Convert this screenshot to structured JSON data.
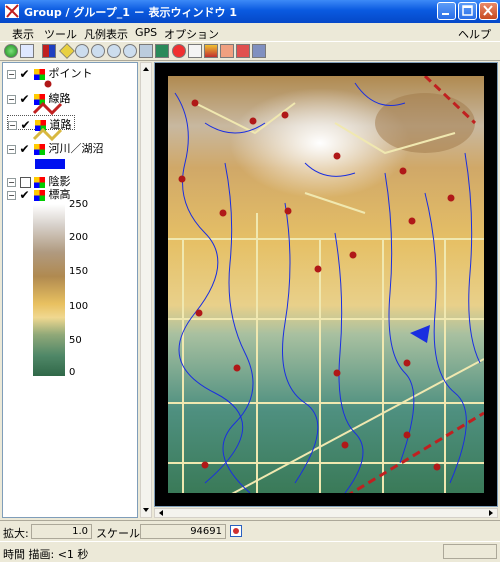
{
  "window": {
    "title": "Group / グループ_1 － 表示ウィンドウ 1"
  },
  "menubar": {
    "items": [
      "表示",
      "ツール",
      "凡例表示",
      "GPS",
      "オプション"
    ],
    "help": "ヘルプ"
  },
  "legend": {
    "layers": [
      {
        "label": "ポイント",
        "checked": true
      },
      {
        "label": "線路",
        "checked": true
      },
      {
        "label": "道路",
        "checked": true
      },
      {
        "label": "河川／湖沼",
        "checked": true
      },
      {
        "label": "陰影",
        "checked": false
      },
      {
        "label": "標高",
        "checked": true
      }
    ],
    "elevation_ticks": [
      "250",
      "200",
      "150",
      "100",
      "50",
      "0"
    ]
  },
  "status": {
    "zoom_label": "拡大:",
    "zoom_value": "1.0",
    "scale_label": "スケール:",
    "scale_value": "94691",
    "time_text": "時間 描画: <1 秒"
  },
  "colors": {
    "title_bar": "#0a5ae0",
    "point": "#b01818",
    "river": "#1a2ee0",
    "road": "#f0e8b0",
    "rail": "#c02020"
  }
}
